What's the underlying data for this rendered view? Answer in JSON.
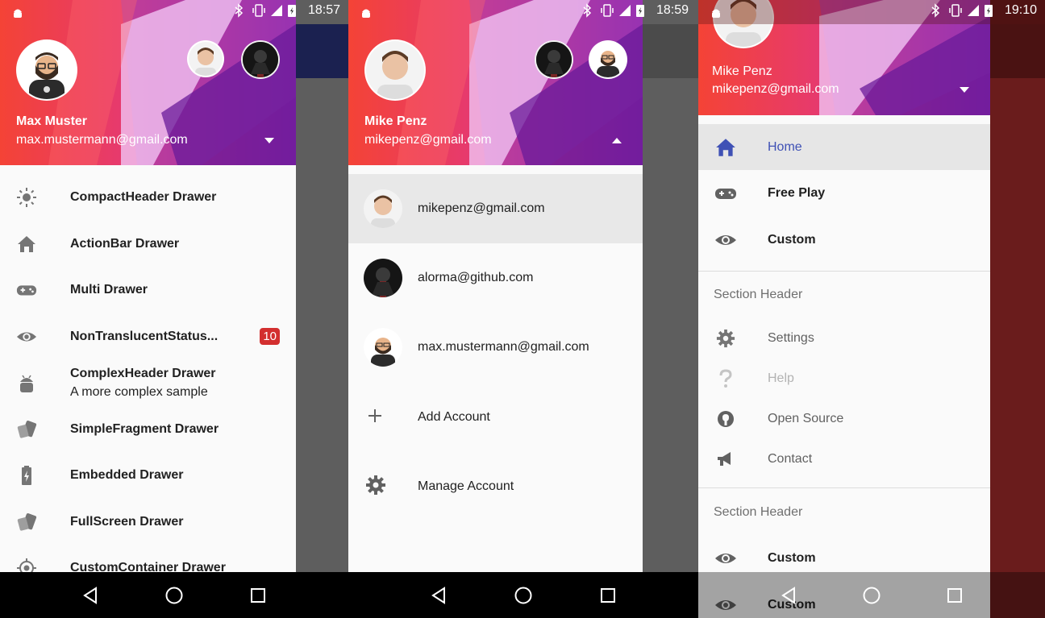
{
  "colors": {
    "accent": "#3f51b5",
    "badge": "#d32f2f",
    "header_red": "#f44336",
    "header_purple": "#8e24aa"
  },
  "screen1": {
    "status_time": "18:57",
    "profile": {
      "name": "Max Muster",
      "email": "max.mustermann@gmail.com"
    },
    "items": [
      {
        "icon": "sun-icon",
        "label": "CompactHeader Drawer"
      },
      {
        "icon": "home-icon",
        "label": "ActionBar Drawer"
      },
      {
        "icon": "gamepad-icon",
        "label": "Multi Drawer"
      },
      {
        "icon": "eye-icon",
        "label": "NonTranslucentStatus...",
        "badge": "10"
      },
      {
        "icon": "android-icon",
        "label": "ComplexHeader Drawer",
        "sub": "A more complex sample"
      },
      {
        "icon": "cards-icon",
        "label": "SimpleFragment Drawer"
      },
      {
        "icon": "battery-icon",
        "label": "Embedded Drawer"
      },
      {
        "icon": "cards-icon",
        "label": "FullScreen Drawer"
      },
      {
        "icon": "crosshair-icon",
        "label": "CustomContainer Drawer"
      }
    ]
  },
  "screen2": {
    "status_time": "18:59",
    "profile": {
      "name": "Mike Penz",
      "email": "mikepenz@gmail.com"
    },
    "accounts": [
      {
        "label": "mikepenz@gmail.com",
        "avatar": "avatar-mike"
      },
      {
        "label": "alorma@github.com",
        "avatar": "avatar-alorma"
      },
      {
        "label": "max.mustermann@gmail.com",
        "avatar": "avatar-max"
      }
    ],
    "actions": [
      {
        "icon": "plus-icon",
        "label": "Add Account"
      },
      {
        "icon": "gear-icon",
        "label": "Manage Account"
      }
    ]
  },
  "screen3": {
    "status_time": "19:10",
    "profile": {
      "name": "Mike Penz",
      "email": "mikepenz@gmail.com"
    },
    "primary": [
      {
        "icon": "home-icon",
        "label": "Home",
        "selected": true
      },
      {
        "icon": "gamepad-icon",
        "label": "Free Play"
      },
      {
        "icon": "eye-icon",
        "label": "Custom"
      }
    ],
    "section1": "Section Header",
    "secondary": [
      {
        "icon": "gear-icon",
        "label": "Settings"
      },
      {
        "icon": "question-icon",
        "label": "Help",
        "disabled": true
      },
      {
        "icon": "github-icon",
        "label": "Open Source"
      },
      {
        "icon": "megaphone-icon",
        "label": "Contact"
      }
    ],
    "section2": "Section Header",
    "tertiary": [
      {
        "icon": "eye-icon",
        "label": "Custom"
      },
      {
        "icon": "eye-icon",
        "label": "Custom"
      }
    ]
  }
}
